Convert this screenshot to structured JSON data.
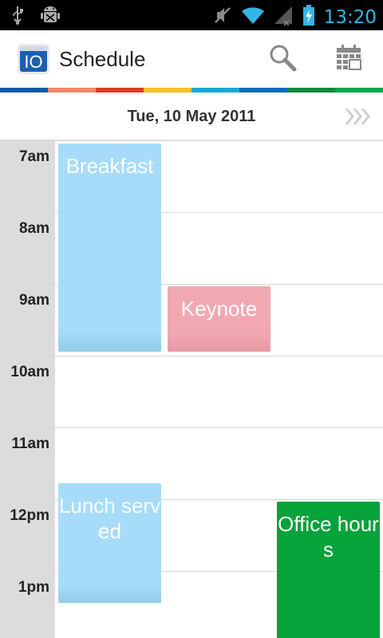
{
  "status_bar": {
    "time": "13:20",
    "icons": [
      "usb-icon",
      "android-debug-icon",
      "mute-icon",
      "wifi-icon",
      "signal-icon",
      "battery-charging-icon"
    ]
  },
  "action_bar": {
    "logo_text": "IO",
    "title": "Schedule",
    "actions": [
      "search-icon",
      "calendar-icon"
    ]
  },
  "day_header": {
    "date": "Tue, 10 May 2011"
  },
  "hours": [
    "7am",
    "8am",
    "9am",
    "10am",
    "11am",
    "12pm",
    "1pm"
  ],
  "blocks": [
    {
      "label": "Breakfast",
      "color": "#a6dcfa"
    },
    {
      "label": "Keynote",
      "color": "#f1a8b1"
    },
    {
      "label": "Lunch served",
      "color": "#a6dcfa"
    },
    {
      "label": "Office hours",
      "color": "#06a23a"
    }
  ],
  "colors": {
    "accent": "#33b5e5",
    "strip": [
      "#0f5aa8",
      "#f08a6c",
      "#e03a2a",
      "#f6c12a",
      "#19a8d0",
      "#0b6bb8",
      "#108a3d",
      "#0ca54d"
    ]
  }
}
